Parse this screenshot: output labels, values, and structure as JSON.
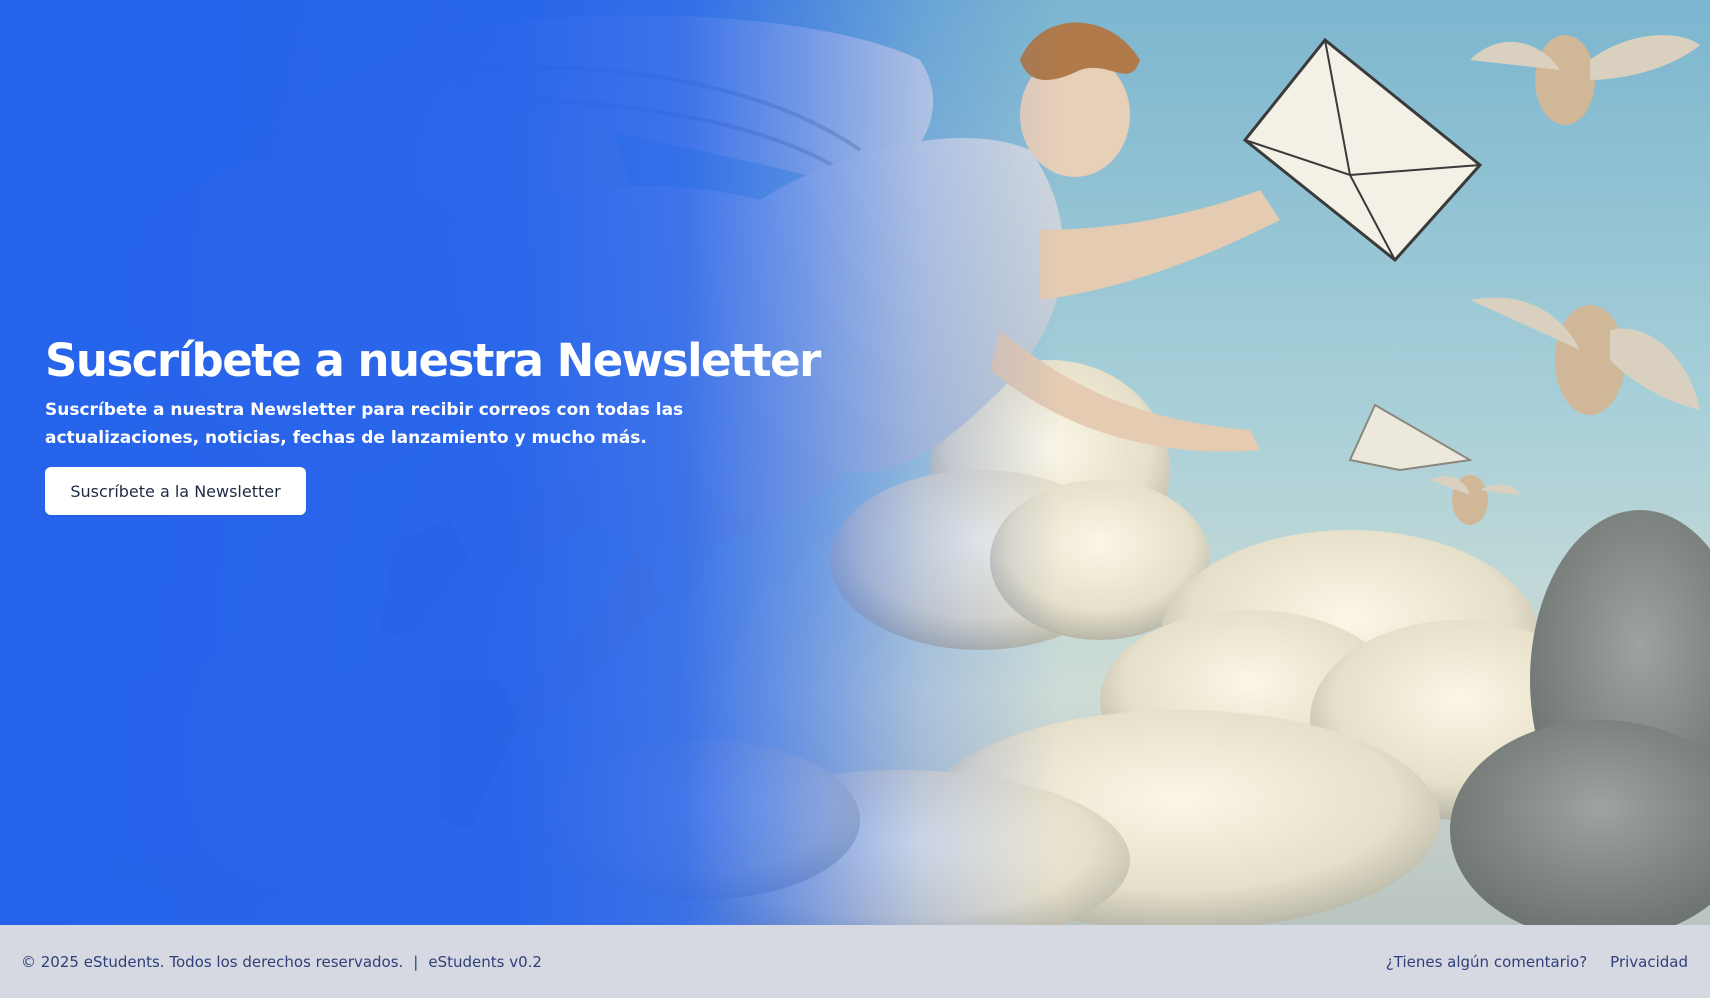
{
  "hero": {
    "title": "Suscríbete a nuestra Newsletter",
    "subtitle": "Suscríbete a nuestra Newsletter para recibir correos con todas las actualizaciones, noticias, fechas de lanzamiento y mucho más.",
    "button_label": "Suscríbete a la Newsletter",
    "illustration": "angel-messenger-with-envelope-in-clouds",
    "overlay_color": "#2563eb"
  },
  "footer": {
    "copyright": "© 2025 eStudents. Todos los derechos reservados.",
    "separator": "|",
    "version": "eStudents v0.2",
    "links": [
      {
        "label": "¿Tienes algún comentario?"
      },
      {
        "label": "Privacidad"
      }
    ]
  }
}
